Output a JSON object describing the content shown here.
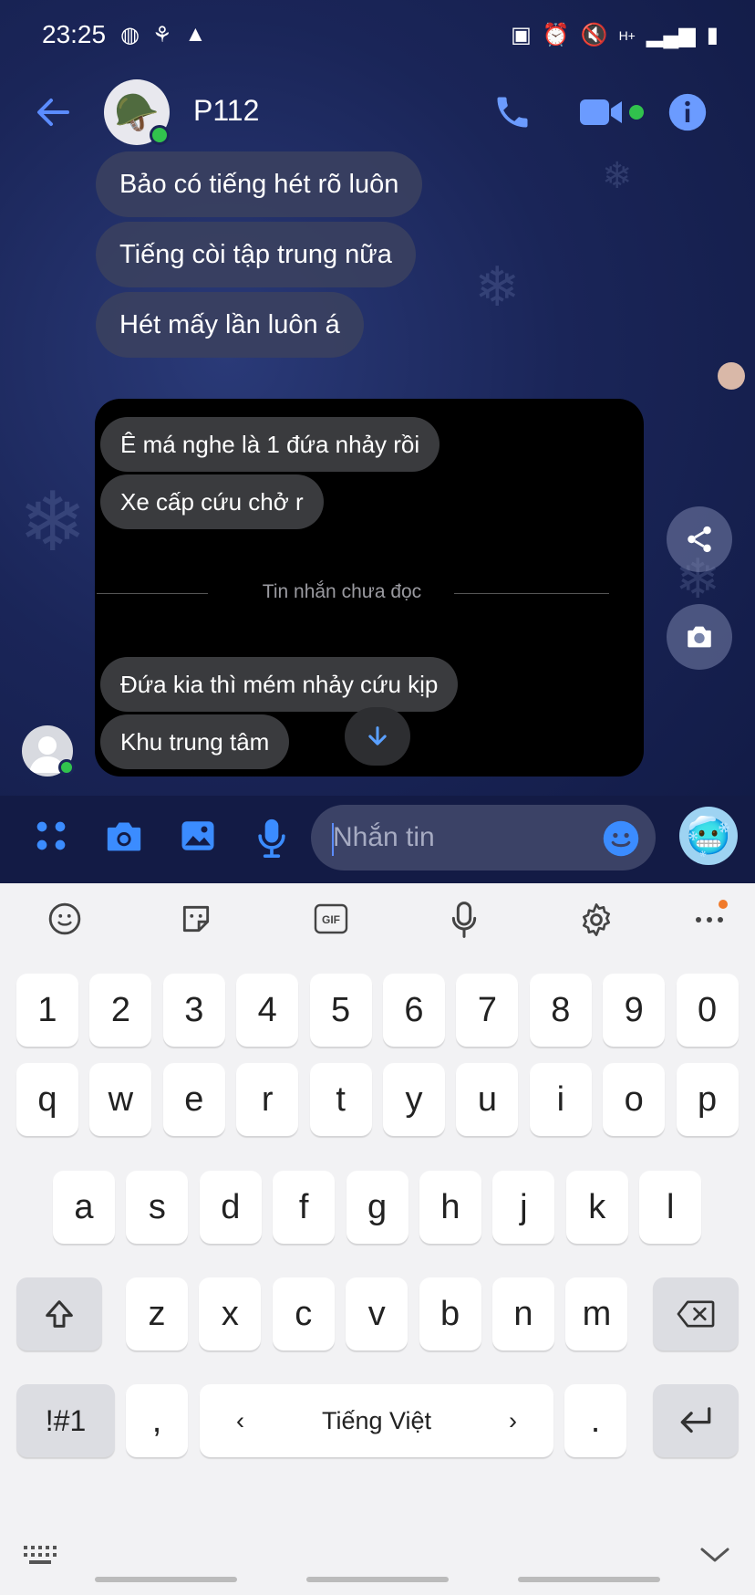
{
  "status_bar": {
    "time": "23:25"
  },
  "header": {
    "contact_name": "P112"
  },
  "messages_top": [
    {
      "text": "Bảo có tiếng hét rõ luôn"
    },
    {
      "text": "Tiếng còi tập trung nữa"
    },
    {
      "text": "Hét mấy lần luôn á"
    }
  ],
  "panel_messages": [
    {
      "text": "Ê má nghe là 1 đứa nhảy rồi"
    },
    {
      "text": "Xe cấp cứu chở r"
    },
    {
      "text": "Đứa kia thì mém nhảy cứu kịp"
    },
    {
      "text": "Khu trung tâm"
    }
  ],
  "divider": {
    "text": "Tin nhắn chưa đọc"
  },
  "composer": {
    "placeholder": "Nhắn tin"
  },
  "keyboard": {
    "row_numbers": [
      "1",
      "2",
      "3",
      "4",
      "5",
      "6",
      "7",
      "8",
      "9",
      "0"
    ],
    "row_q": [
      "q",
      "w",
      "e",
      "r",
      "t",
      "y",
      "u",
      "i",
      "o",
      "p"
    ],
    "row_a": [
      "a",
      "s",
      "d",
      "f",
      "g",
      "h",
      "j",
      "k",
      "l"
    ],
    "row_z": [
      "z",
      "x",
      "c",
      "v",
      "b",
      "n",
      "m"
    ],
    "symbols_label": "!#1",
    "comma": ",",
    "space_label": "Tiếng Việt",
    "space_left": "‹",
    "space_right": "›",
    "period": ".",
    "gif_label": "GIF"
  },
  "colors": {
    "accent": "#3b8cff",
    "online": "#31c24d",
    "chat_bg": "#1a2558",
    "keyboard_bg": "#f2f2f4"
  }
}
